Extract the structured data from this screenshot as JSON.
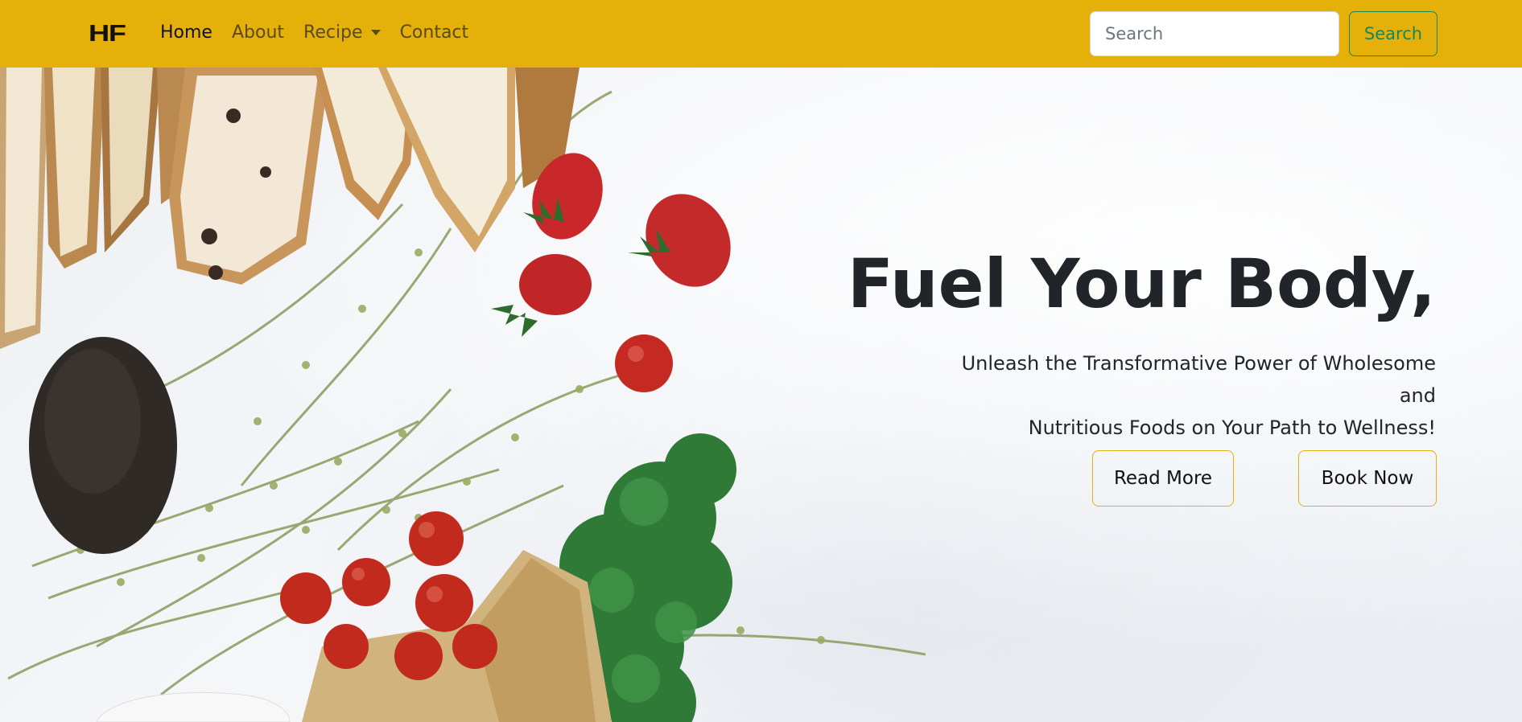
{
  "nav": {
    "brand": "HF",
    "links": [
      {
        "label": "Home",
        "active": true
      },
      {
        "label": "About",
        "active": false
      },
      {
        "label": "Recipe",
        "active": false,
        "dropdown": true
      },
      {
        "label": "Contact",
        "active": false
      }
    ],
    "search_placeholder": "Search",
    "search_button": "Search"
  },
  "hero": {
    "title": "Fuel Your Body,",
    "subtitle_line1": "Unleash the Transformative Power of Wholesome and",
    "subtitle_line2": "Nutritious Foods on Your Path to Wellness!",
    "read_more": "Read More",
    "book_now": "Book Now"
  },
  "colors": {
    "navbar": "#e6b00a",
    "search_button": "#198754",
    "button_border": "#e6b00a",
    "text": "#212529"
  }
}
